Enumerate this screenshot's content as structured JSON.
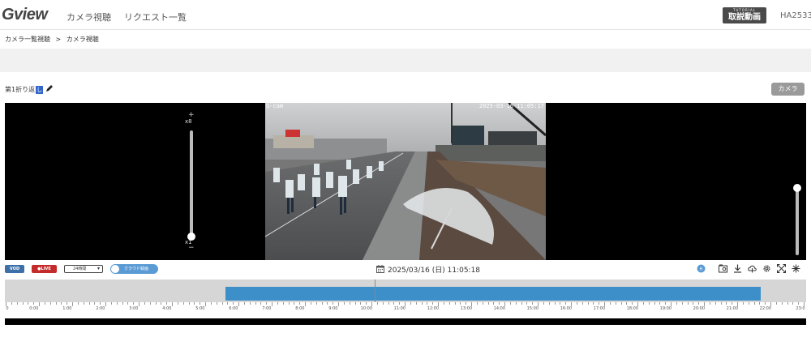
{
  "header": {
    "logo": "Gview",
    "nav": [
      "カメラ視聴",
      "リクエスト一覧"
    ],
    "tutorial_small": "TUTORIAL",
    "tutorial_big": "取説動画",
    "account": "HA2533"
  },
  "breadcrumb": {
    "items": [
      "カメラ一覧視聴",
      ">",
      "カメラ視聴"
    ]
  },
  "camera": {
    "name": "第1折り返",
    "name_cursor": "し",
    "camera_button": "カメラ"
  },
  "video": {
    "osd_left": "G-cam",
    "osd_right": "2025-03-16 11:05:17",
    "zoom_plus": "+",
    "zoom_max": "x8",
    "zoom_min": "x1",
    "zoom_minus": "−",
    "zoom_level_fraction": 0.0,
    "volume_fraction": 1.0
  },
  "controls": {
    "vod_label": "VOD",
    "live_label": "●LIVE",
    "range_selected": "24時間",
    "cloud_label": "クラウド録画",
    "datetime": "2025/03/16 (日) 11:05:18",
    "icons": [
      "hd-icon",
      "snapshot-icon",
      "download-icon",
      "cloud-icon",
      "settings-icon",
      "fullscreen-icon",
      "extra-icon"
    ]
  },
  "timeline": {
    "recorded_start_hour": 6.6,
    "recorded_end_hour": 22.7,
    "cursor_hour": 11.09,
    "hour_labels": [
      "0",
      "0:00",
      "1:00",
      "2:00",
      "3:00",
      "4:00",
      "5:00",
      "6:00",
      "7:00",
      "8:00",
      "9:00",
      "10:00",
      "11:00",
      "12:00",
      "13:00",
      "14:00",
      "15:00",
      "16:00",
      "17:00",
      "18:00",
      "19:00",
      "20:00",
      "21:00",
      "22:00",
      "23:0"
    ]
  },
  "colors": {
    "vod": "#3d6fa8",
    "live": "#c42b2b",
    "cloud_toggle": "#5b9bd5",
    "timeline_range": "#3d8fc9"
  }
}
